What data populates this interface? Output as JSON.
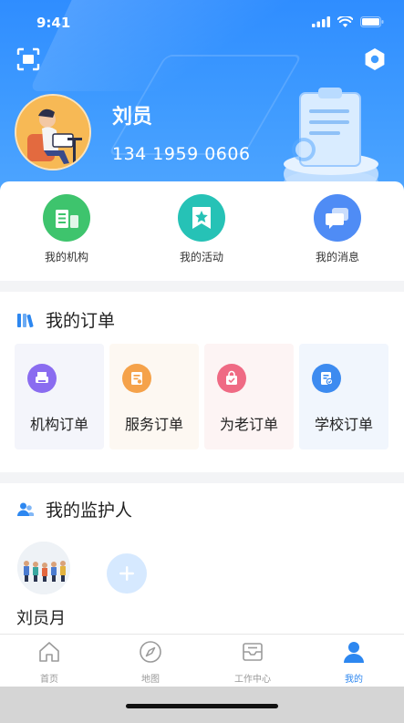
{
  "status": {
    "time": "9:41"
  },
  "user": {
    "name": "刘员",
    "phone": "134 1959 0606"
  },
  "quick_menu": [
    {
      "label": "我的机构",
      "icon": "building-doc-icon",
      "color": "#3ec46d"
    },
    {
      "label": "我的活动",
      "icon": "star-bookmark-icon",
      "color": "#26c2b6"
    },
    {
      "label": "我的消息",
      "icon": "chat-bubble-icon",
      "color": "#4f8cf5"
    }
  ],
  "orders": {
    "title": "我的订单",
    "items": [
      {
        "label": "机构订单",
        "icon": "printer-icon",
        "color": "#8a6cf0",
        "bg": "#f4f5fb"
      },
      {
        "label": "服务订单",
        "icon": "form-icon",
        "color": "#f5a24a",
        "bg": "#fdf8f2"
      },
      {
        "label": "为老订单",
        "icon": "shopping-bag-icon",
        "color": "#ef6a84",
        "bg": "#fdf4f4"
      },
      {
        "label": "学校订单",
        "icon": "document-check-icon",
        "color": "#3d8bf0",
        "bg": "#f1f6fd"
      }
    ]
  },
  "guardians": {
    "title": "我的监护人",
    "items": [
      {
        "name": "刘员月"
      }
    ]
  },
  "tabs": [
    {
      "label": "首页",
      "icon": "home-icon"
    },
    {
      "label": "地图",
      "icon": "compass-icon"
    },
    {
      "label": "工作中心",
      "icon": "inbox-icon"
    },
    {
      "label": "我的",
      "icon": "person-icon",
      "active": true
    }
  ],
  "colors": {
    "primary": "#2d87f0",
    "header": "#3f9bff"
  }
}
